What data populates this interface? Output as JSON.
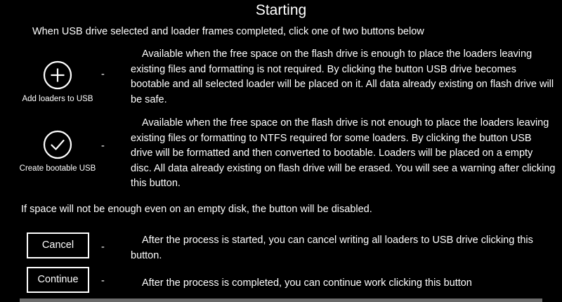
{
  "title": "Starting",
  "intro": "When USB drive selected and loader frames completed, click one of two buttons below",
  "colors": {
    "background": "#000000",
    "text": "#ffffff",
    "bottom_bar": "#6b6b6b"
  },
  "actions": {
    "add": {
      "icon": "plus-circle-icon",
      "label": "Add loaders to USB",
      "dash": "-",
      "description": "Available when the free space on the flash drive is enough to place the loaders leaving existing files and formatting is not required. By clicking the button USB drive becomes bootable and all selected loader will be placed on it. All data already existing on flash drive will be safe."
    },
    "create": {
      "icon": "check-circle-icon",
      "label": "Create bootable USB",
      "dash": "-",
      "description": "Available when the free space on the flash drive is not enough to place the loaders leaving existing files or formatting to NTFS required for some loaders. By clicking the button USB drive will be formatted and then converted to bootable. Loaders will be placed on a empty disc. All data already existing on flash drive will be erased. You will see a warning after clicking this button."
    }
  },
  "note": "If space will not be enough even on an empty disk, the button will be disabled.",
  "buttons": {
    "cancel": {
      "label": "Cancel",
      "dash": "-",
      "description": "After the process is started, you can cancel writing all loaders to USB drive clicking this button."
    },
    "continue": {
      "label": "Continue",
      "dash": "-",
      "description": "After the process is completed, you can continue work clicking this button"
    }
  }
}
